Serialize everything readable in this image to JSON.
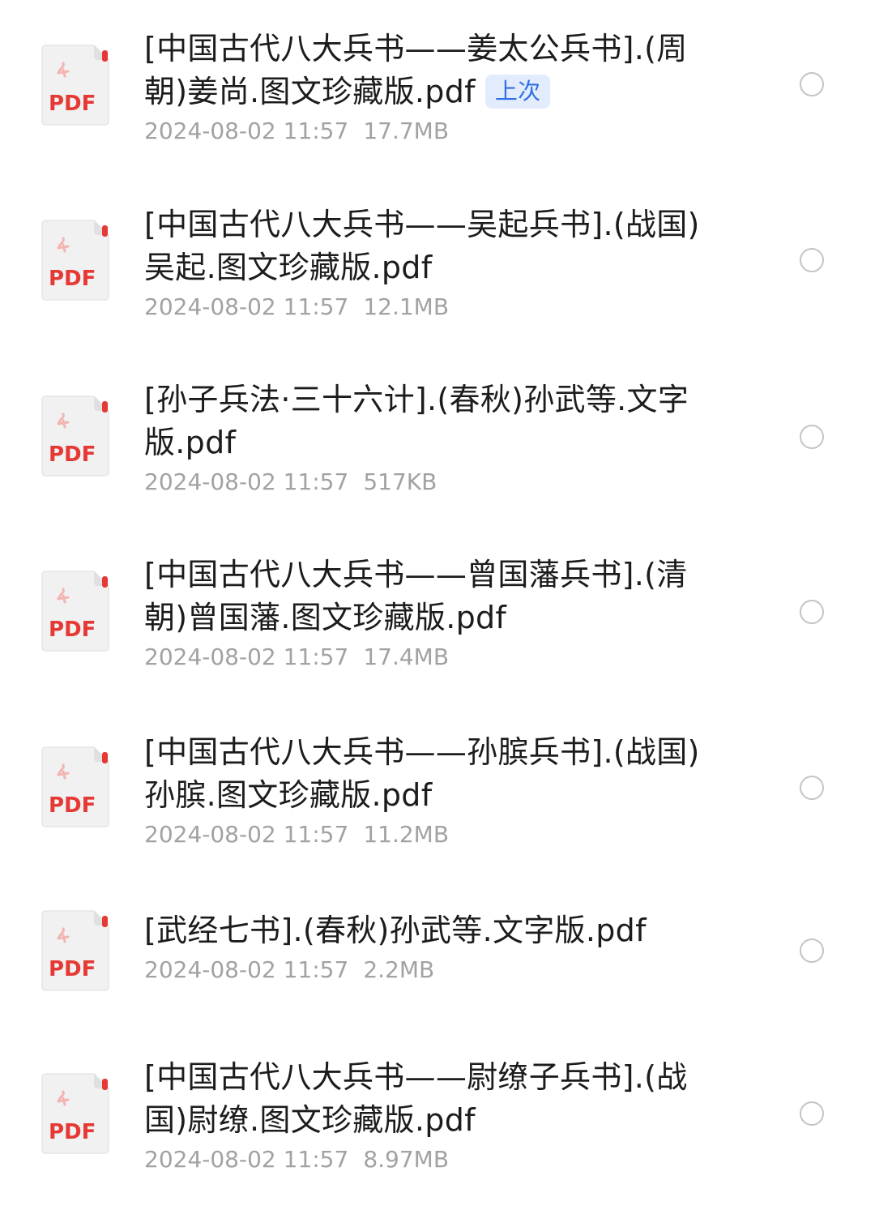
{
  "colors": {
    "pdf_red": "#e53935",
    "badge_bg": "#e3ecfd",
    "badge_text": "#2f6fe4",
    "meta_text": "#a2a2a2",
    "name_text": "#1c1c1c"
  },
  "icon_label": "PDF",
  "files": [
    {
      "name": "[中国古代八大兵书——姜太公兵书].(周朝)姜尚.图文珍藏版.pdf",
      "badge": "上次",
      "date": "2024-08-02 11:57",
      "size": "17.7MB",
      "icon": "pdf-file-icon"
    },
    {
      "name": "[中国古代八大兵书——吴起兵书].(战国)吴起.图文珍藏版.pdf",
      "date": "2024-08-02 11:57",
      "size": "12.1MB",
      "icon": "pdf-file-icon"
    },
    {
      "name": "[孙子兵法·三十六计].(春秋)孙武等.文字版.pdf",
      "date": "2024-08-02 11:57",
      "size": "517KB",
      "icon": "pdf-file-icon"
    },
    {
      "name": "[中国古代八大兵书——曾国藩兵书].(清朝)曾国藩.图文珍藏版.pdf",
      "date": "2024-08-02 11:57",
      "size": "17.4MB",
      "icon": "pdf-file-icon"
    },
    {
      "name": "[中国古代八大兵书——孙膑兵书].(战国)孙膑.图文珍藏版.pdf",
      "date": "2024-08-02 11:57",
      "size": "11.2MB",
      "icon": "pdf-file-icon"
    },
    {
      "name": "[武经七书].(春秋)孙武等.文字版.pdf",
      "date": "2024-08-02 11:57",
      "size": "2.2MB",
      "icon": "pdf-file-icon"
    },
    {
      "name": "[中国古代八大兵书——尉缭子兵书].(战国)尉缭.图文珍藏版.pdf",
      "date": "2024-08-02 11:57",
      "size": "8.97MB",
      "icon": "pdf-file-icon"
    }
  ]
}
